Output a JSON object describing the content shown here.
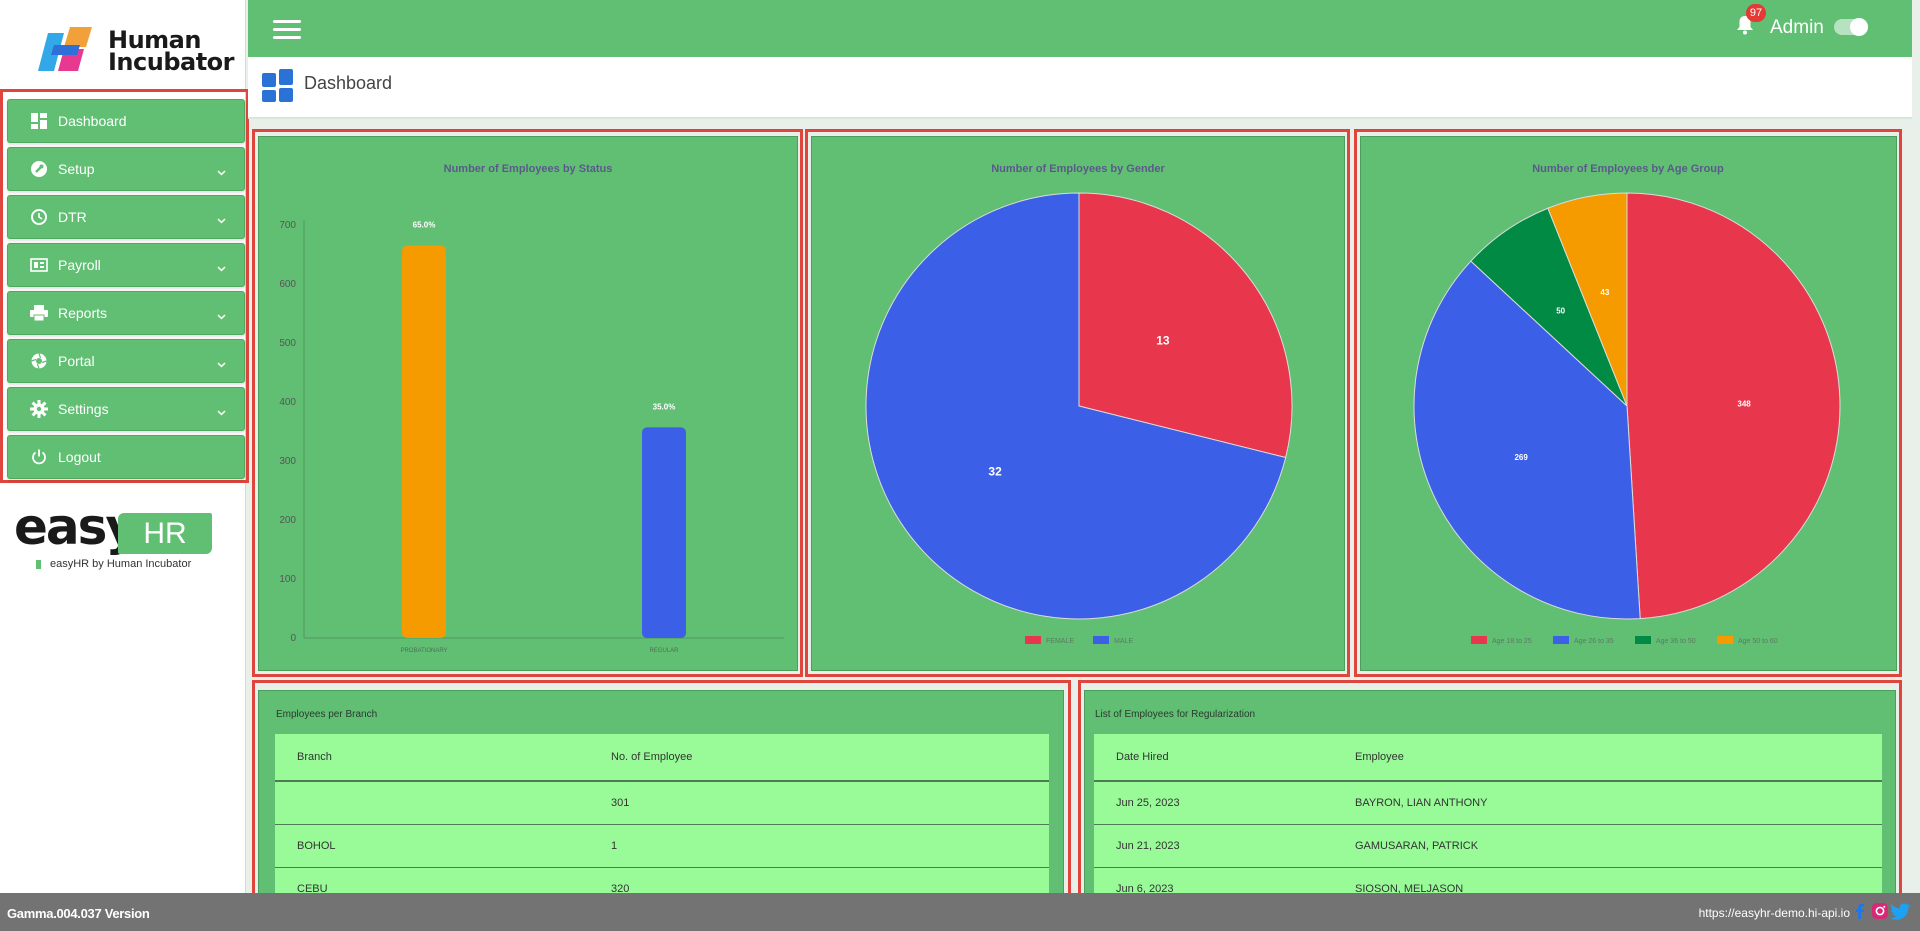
{
  "brand": {
    "logo_text_line1": "Human",
    "logo_text_line2": "Incubator",
    "easyhr_big": "easy",
    "easyhr_box": "HR",
    "easyhr_sub": "easyHR by Human Incubator"
  },
  "sidebar": {
    "items": [
      {
        "label": "Dashboard",
        "icon": "dashboard-icon",
        "expandable": false
      },
      {
        "label": "Setup",
        "icon": "wrench-icon",
        "expandable": true
      },
      {
        "label": "DTR",
        "icon": "clock-icon",
        "expandable": true
      },
      {
        "label": "Payroll",
        "icon": "payroll-icon",
        "expandable": true
      },
      {
        "label": "Reports",
        "icon": "printer-icon",
        "expandable": true
      },
      {
        "label": "Portal",
        "icon": "aperture-icon",
        "expandable": true
      },
      {
        "label": "Settings",
        "icon": "gear-icon",
        "expandable": true
      },
      {
        "label": "Logout",
        "icon": "power-icon",
        "expandable": false
      }
    ]
  },
  "topbar": {
    "notification_count": "97",
    "user": "Admin"
  },
  "page": {
    "title": "Dashboard"
  },
  "chart_data": [
    {
      "type": "bar",
      "title": "Number of Employees by Status",
      "categories": [
        "PROBATIONARY",
        "REGULAR"
      ],
      "values": [
        665,
        357
      ],
      "data_labels": [
        "65.0%",
        "35.0%"
      ],
      "colors": [
        "#f59b00",
        "#3b5fe6"
      ],
      "ylim": [
        0,
        700
      ],
      "yticks": [
        0,
        100,
        200,
        300,
        400,
        500,
        600,
        700
      ],
      "grid": false
    },
    {
      "type": "pie",
      "title": "Number of Employees by Gender",
      "labels": [
        "FEMALE",
        "MALE"
      ],
      "values": [
        13,
        32
      ],
      "colors": [
        "#e8374d",
        "#3b5fe6"
      ],
      "legend": "bottom"
    },
    {
      "type": "pie",
      "title": "Number of Employees by Age Group",
      "labels": [
        "Age 18 to 25",
        "Age 26 to 35",
        "Age 36 to 50",
        "Age 50 to 60"
      ],
      "values": [
        348,
        269,
        50,
        43
      ],
      "colors": [
        "#e8374d",
        "#3b5fe6",
        "#008a44",
        "#f59b00"
      ],
      "legend": "bottom"
    }
  ],
  "branch_table": {
    "title": "Employees per Branch",
    "headers": [
      "Branch",
      "No. of Employee"
    ],
    "rows": [
      [
        "",
        "301"
      ],
      [
        "BOHOL",
        "1"
      ],
      [
        "CEBU",
        "320"
      ]
    ]
  },
  "regularization_table": {
    "title": "List of Employees for Regularization",
    "headers": [
      "Date Hired",
      "Employee"
    ],
    "rows": [
      [
        "Jun 25, 2023",
        "BAYRON, LIAN ANTHONY"
      ],
      [
        "Jun 21, 2023",
        "GAMUSARAN, PATRICK"
      ],
      [
        "Jun 6, 2023",
        "SIOSON, MELJASON"
      ]
    ]
  },
  "footer": {
    "version": "Gamma.004.037 Version",
    "url": "https://easyhr-demo.hi-api.io"
  }
}
